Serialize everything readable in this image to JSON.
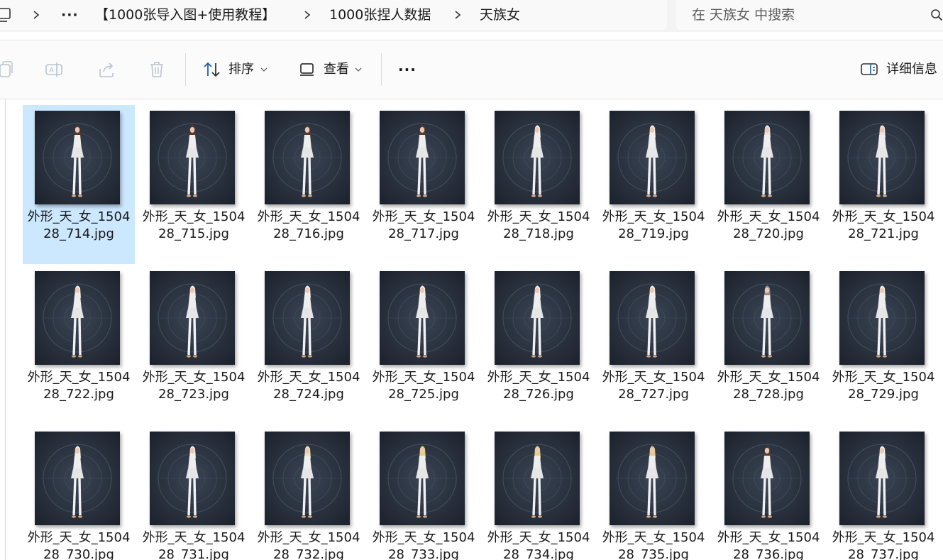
{
  "breadcrumb": {
    "items": [
      "【1000张导入图+使用教程】",
      "1000张捏人数据",
      "天族女"
    ],
    "overflow": "···"
  },
  "search": {
    "placeholder": "在 天族女 中搜索"
  },
  "toolbar": {
    "sort_label": "排序",
    "view_label": "查看",
    "more_label": "···",
    "details_label": "详细信息"
  },
  "files": [
    {
      "name": "外形_天_女_150428_714.jpg",
      "selected": true,
      "hair": "#5b3a2a"
    },
    {
      "name": "外形_天_女_150428_715.jpg",
      "selected": false,
      "hair": "#5b3a2a"
    },
    {
      "name": "外形_天_女_150428_716.jpg",
      "selected": false,
      "hair": "#5b3a2a"
    },
    {
      "name": "外形_天_女_150428_717.jpg",
      "selected": false,
      "hair": "#5b3a2a"
    },
    {
      "name": "外形_天_女_150428_718.jpg",
      "selected": false,
      "hair": "#f1efe9"
    },
    {
      "name": "外形_天_女_150428_719.jpg",
      "selected": false,
      "hair": "#f1efe9"
    },
    {
      "name": "外形_天_女_150428_720.jpg",
      "selected": false,
      "hair": "#ece4e6"
    },
    {
      "name": "外形_天_女_150428_721.jpg",
      "selected": false,
      "hair": "#ece4e6"
    },
    {
      "name": "外形_天_女_150428_722.jpg",
      "selected": false,
      "hair": "#f1efe9"
    },
    {
      "name": "外形_天_女_150428_723.jpg",
      "selected": false,
      "hair": "#f1efe9"
    },
    {
      "name": "外形_天_女_150428_724.jpg",
      "selected": false,
      "hair": "#f1efe9"
    },
    {
      "name": "外形_天_女_150428_725.jpg",
      "selected": false,
      "hair": "#f1efe9"
    },
    {
      "name": "外形_天_女_150428_726.jpg",
      "selected": false,
      "hair": "#f1efe9"
    },
    {
      "name": "外形_天_女_150428_727.jpg",
      "selected": false,
      "hair": "#f1efe9"
    },
    {
      "name": "外形_天_女_150428_728.jpg",
      "selected": false,
      "hair": "#9a8a8a"
    },
    {
      "name": "外形_天_女_150428_729.jpg",
      "selected": false,
      "hair": "#f1efe9"
    },
    {
      "name": "外形_天_女_150428_730.jpg",
      "selected": false,
      "hair": "#f1efe9"
    },
    {
      "name": "外形_天_女_150428_731.jpg",
      "selected": false,
      "hair": "#f1efe9"
    },
    {
      "name": "外形_天_女_150428_732.jpg",
      "selected": false,
      "hair": "#efe0b8"
    },
    {
      "name": "外形_天_女_150428_733.jpg",
      "selected": false,
      "hair": "#e8cf7a"
    },
    {
      "name": "外形_天_女_150428_734.jpg",
      "selected": false,
      "hair": "#e8cf7a"
    },
    {
      "name": "外形_天_女_150428_735.jpg",
      "selected": false,
      "hair": "#e2c98a"
    },
    {
      "name": "外形_天_女_150428_736.jpg",
      "selected": false,
      "hair": "#5b3a2a"
    },
    {
      "name": "外形_天_女_150428_737.jpg",
      "selected": false,
      "hair": "#f1efe9"
    }
  ]
}
